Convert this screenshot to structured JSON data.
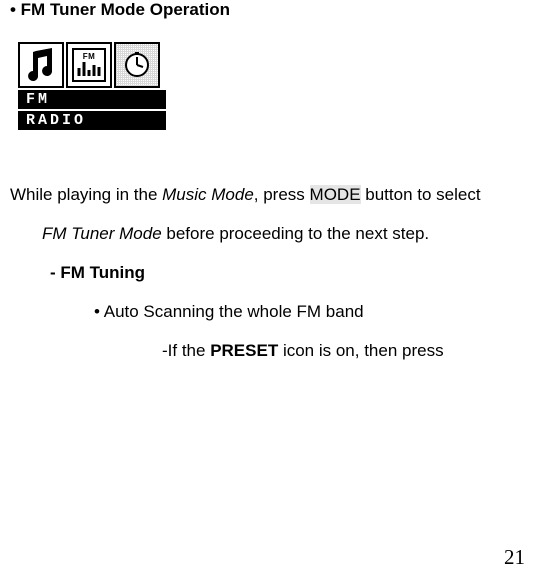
{
  "heading": "• FM Tuner Mode Operation",
  "device": {
    "line1": "FM",
    "line2": "RADIO",
    "center_label": "FM"
  },
  "body": {
    "p1_a": "While playing in the ",
    "p1_music_mode": "Music Mode",
    "p1_b": ", press ",
    "p1_mode_btn": "MODE",
    "p1_c": " button to select",
    "p2_a": "FM Tuner Mode",
    "p2_b": " before proceeding to the next step.",
    "sub1": "- FM Tuning",
    "sub2": "• Auto Scanning the whole FM band",
    "sub3_a": "-If the ",
    "sub3_preset": "PRESET",
    "sub3_b": " icon is on, then press"
  },
  "page_number": "21"
}
